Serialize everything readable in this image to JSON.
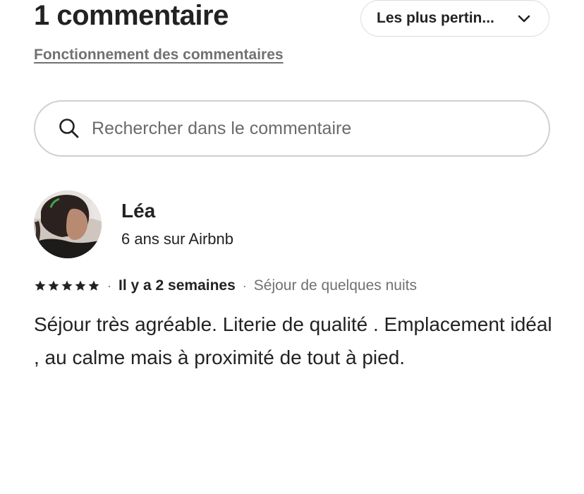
{
  "header": {
    "title": "1 commentaire",
    "sort": {
      "selected": "Les plus pertin...",
      "icon": "chevron-down-icon"
    },
    "how_link": "Fonctionnement des commentaires"
  },
  "search": {
    "placeholder": "Rechercher dans le commentaire",
    "value": "",
    "icon": "search-icon"
  },
  "reviews": [
    {
      "author": "Léa",
      "meta": "6 ans sur Airbnb",
      "rating": 5,
      "rating_max": 5,
      "date": "Il y a 2 semaines",
      "stay_type": "Séjour de quelques nuits",
      "text": "Séjour très agréable. Literie de qualité . Emplacement idéal , au calme mais à proximité de tout à pied."
    }
  ],
  "colors": {
    "text_primary": "#222222",
    "text_secondary": "#717171",
    "border": "#dddddd"
  }
}
